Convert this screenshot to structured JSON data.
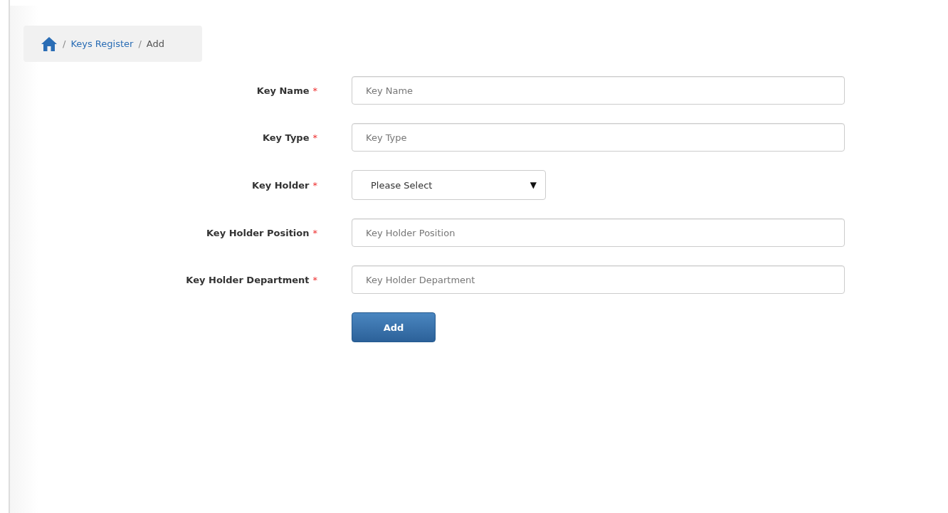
{
  "breadcrumb": {
    "items": [
      {
        "label": "Keys Register",
        "kind": "link"
      },
      {
        "label": "Add",
        "kind": "current"
      }
    ],
    "separator": "/"
  },
  "form": {
    "fields": [
      {
        "label": "Key Name",
        "required_mark": "*",
        "kind": "text",
        "placeholder": "Key Name"
      },
      {
        "label": "Key Type",
        "required_mark": "*",
        "kind": "text",
        "placeholder": "Key Type"
      },
      {
        "label": "Key Holder",
        "required_mark": "*",
        "kind": "select",
        "value": "Please Select",
        "caret": "▼"
      },
      {
        "label": "Key Holder Position",
        "required_mark": "*",
        "kind": "text",
        "placeholder": "Key Holder Position"
      },
      {
        "label": "Key Holder Department",
        "required_mark": "*",
        "kind": "text",
        "placeholder": "Key Holder Department"
      }
    ],
    "submit": "Add"
  }
}
